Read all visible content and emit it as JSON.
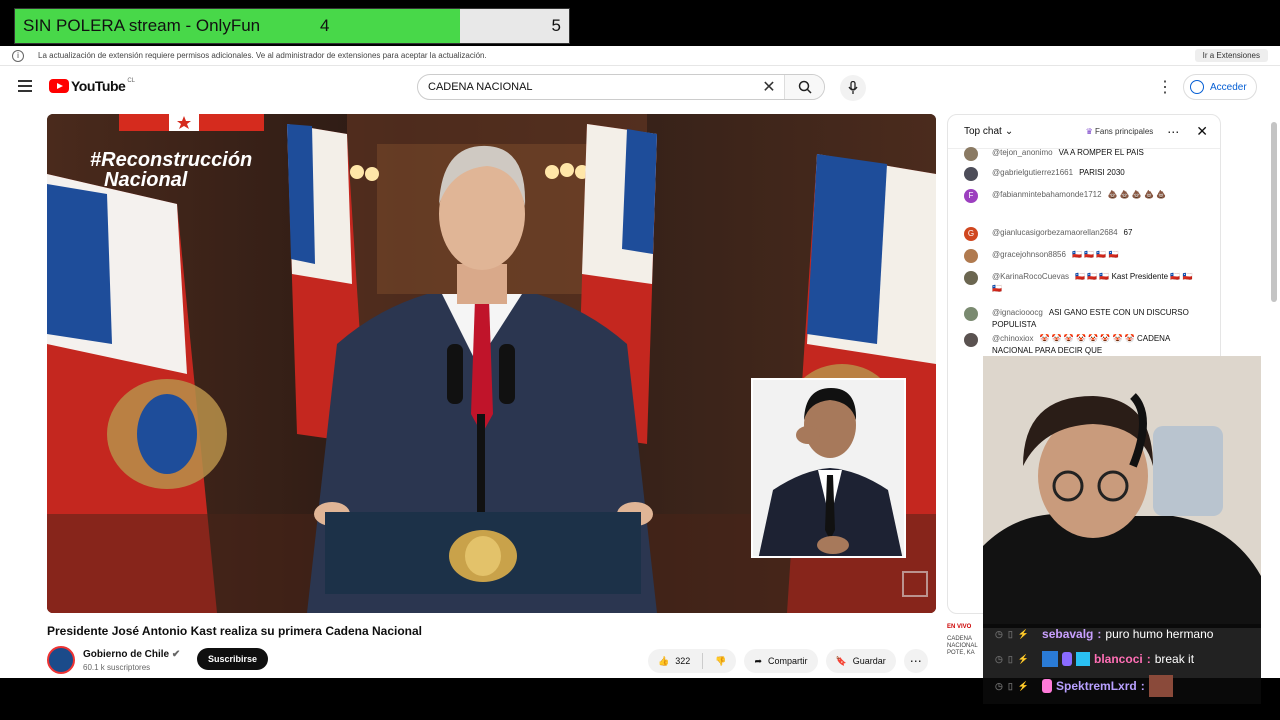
{
  "poll": {
    "title": "SIN POLERA stream - OnlyFun",
    "left_count": "4",
    "right_count": "5",
    "colors": {
      "left": "#48d849",
      "right": "#e8e8e8"
    }
  },
  "browser_notice": {
    "text": "La actualización de extensión requiere permisos adicionales. Ve al administrador de extensiones para aceptar la actualización.",
    "button": "Ir a Extensiones"
  },
  "header": {
    "logo_text": "YouTube",
    "country_code": "CL",
    "search_value": "CADENA NACIONAL",
    "signin_label": "Acceder"
  },
  "video": {
    "hashtag_line1": "#Reconstrucción",
    "hashtag_line2": "Nacional",
    "title": "Presidente José Antonio Kast realiza su primera Cadena Nacional",
    "channel_name": "Gobierno de Chile",
    "subscribers": "60.1 k suscriptores",
    "subscribe_label": "Suscribirse",
    "likes": "322",
    "share_label": "Compartir",
    "save_label": "Guardar"
  },
  "chat": {
    "mode_label": "Top chat",
    "fans_label": "Fans principales",
    "messages": [
      {
        "author": "@tejon_anonimo",
        "text": "VA A ROMPER EL PAIS",
        "avatar_color": "#8a7a63"
      },
      {
        "author": "@gabrielgutierrez1661",
        "text": "PARISI 2030",
        "avatar_color": "#4d4d59"
      },
      {
        "author": "@fabianmintebahamonde1712",
        "text": "💩 💩 💩 💩 💩",
        "avatar_color": "#9c3fbf",
        "avatar_letter": "F"
      },
      {
        "author": "@gianlucasigorbezamaorellan2684",
        "text": "67",
        "avatar_color": "#d0471f",
        "avatar_letter": "G"
      },
      {
        "author": "@gracejohnson8856",
        "text": "🇨🇱 🇨🇱 🇨🇱 🇨🇱",
        "avatar_color": "#b07a4f"
      },
      {
        "author": "@KarinaRocoCuevas",
        "text": "🇨🇱 🇨🇱 🇨🇱 Kast Presidente 🇨🇱 🇨🇱 🇨🇱",
        "avatar_color": "#6b6650"
      },
      {
        "author": "@ignaciooocg",
        "text": "ASI GANO ESTE CON UN DISCURSO POPULISTA",
        "avatar_color": "#7a8a70"
      },
      {
        "author": "@chinoxiox",
        "text": "🤡 🤡 🤡 🤡 🤡 🤡 🤡 🤡 CADENA NACIONAL PARA DECIR QUE",
        "avatar_color": "#5a5250"
      }
    ],
    "bottom_label": "EN VIVO",
    "bottom_sub": "CADENA NACIONAL POTE, KA"
  },
  "stream_chat": [
    {
      "user": "sebavalg",
      "text": "puro humo hermano",
      "color": "#c9a0ff"
    },
    {
      "user": "blancoci",
      "text": "break it",
      "color": "#ff6fb5"
    },
    {
      "user": "SpektremLxrd",
      "text": "",
      "color": "#b8a0ff"
    }
  ]
}
